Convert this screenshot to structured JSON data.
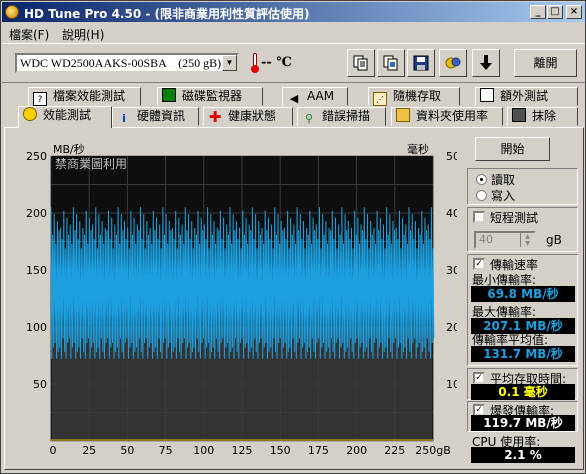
{
  "window": {
    "title": "HD Tune Pro 4.50 - (限非商業用利性質評估使用)",
    "controls": {
      "minimize": "_",
      "maximize": "□",
      "close": "×"
    }
  },
  "menu": {
    "file": "檔案(F)",
    "help": "說明(H)"
  },
  "toolbar": {
    "drive": "WDC WD2500AAKS-00SBA    (250 gB)",
    "temperature": "-- ℃",
    "exit_label": "離開",
    "icons": [
      "copy-text-icon",
      "copy-image-icon",
      "save-icon",
      "options-icon",
      "download-icon"
    ]
  },
  "tabs_top": [
    {
      "label": "檔案效能測試",
      "icon": "file-benchmark-icon"
    },
    {
      "label": "磁碟監視器",
      "icon": "disk-monitor-icon"
    },
    {
      "label": "AAM",
      "icon": "speaker-icon"
    },
    {
      "label": "隨機存取",
      "icon": "random-access-icon"
    },
    {
      "label": "額外測試",
      "icon": "extra-tests-icon"
    }
  ],
  "tabs_bottom": [
    {
      "label": "效能測試",
      "icon": "benchmark-icon",
      "active": true
    },
    {
      "label": "硬體資訊",
      "icon": "info-icon"
    },
    {
      "label": "健康狀態",
      "icon": "health-icon"
    },
    {
      "label": "錯誤掃描",
      "icon": "error-scan-icon"
    },
    {
      "label": "資料夾使用率",
      "icon": "folder-icon"
    },
    {
      "label": "抹除",
      "icon": "erase-icon"
    }
  ],
  "chart_data": {
    "type": "line",
    "title": "",
    "watermark": "禁商業圖利用",
    "y_left_label": "MB/秒",
    "y_right_label": "毫秒",
    "y_left_ticks": [
      "250",
      "200",
      "150",
      "100",
      "50"
    ],
    "y_right_ticks": [
      "50",
      "40",
      "30",
      "20",
      "10"
    ],
    "x_ticks": [
      "0",
      "25",
      "50",
      "75",
      "100",
      "125",
      "150",
      "175",
      "200",
      "225",
      "250gB"
    ],
    "ylim_left": [
      0,
      250
    ],
    "ylim_right": [
      0,
      50
    ],
    "xlim": [
      0,
      250
    ],
    "series": [
      {
        "color": "#1ea0e0",
        "band_min": 70,
        "band_max": 205,
        "median": 131.7
      },
      {
        "color": "#e0c000",
        "access_ms": 0.1
      }
    ],
    "colors": {
      "background": "#000000",
      "grid": "#3a3a3a",
      "read": "#1ea0e0",
      "access": "#e0c000"
    }
  },
  "side": {
    "start_label": "開始",
    "read_label": "讀取",
    "write_label": "寫入",
    "short_test_label": "短程測試",
    "short_test_value": "40",
    "short_test_unit": "gB",
    "transfer_rate_label": "傳輸速率",
    "min_label": "最小傳輸率:",
    "min_value": "69.8 MB/秒",
    "max_label": "最大傳輸率:",
    "max_value": "207.1 MB/秒",
    "avg_label": "傳輸率平均值:",
    "avg_value": "131.7 MB/秒",
    "access_label": "平均存取時間:",
    "access_value": "0.1 毫秒",
    "burst_label": "爆發傳輸率:",
    "burst_value": "119.7 MB/秒",
    "cpu_label": "CPU 使用率:",
    "cpu_value": "2.1 %",
    "colors": {
      "blue_value": "#1ea0e0",
      "yellow_value": "#ffff00",
      "white_value": "#ffffff"
    }
  }
}
